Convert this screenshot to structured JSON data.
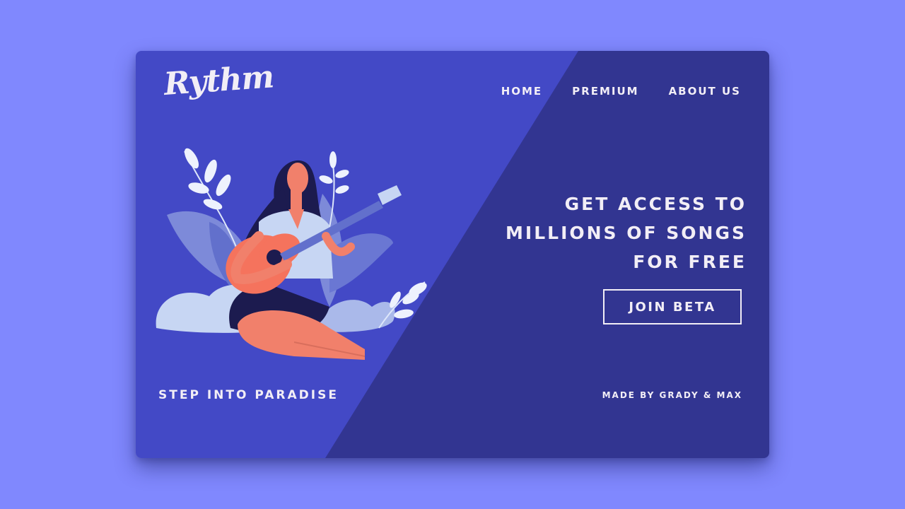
{
  "brand": {
    "logo_text": "Rythm"
  },
  "nav": {
    "home": "HOME",
    "premium": "PREMIUM",
    "about": "ABOUT US"
  },
  "hero": {
    "headline_lines": [
      "GET ACCESS TO",
      "MILLIONS OF SONGS",
      "FOR FREE"
    ],
    "cta_label": "JOIN BETA"
  },
  "footer": {
    "tagline": "STEP INTO PARADISE",
    "credits": "MADE BY GRADY & MAX"
  },
  "colors": {
    "page_background": "#8088fe",
    "card_left": "#4349c6",
    "card_right": "#323591",
    "text": "#f2eef6",
    "accent_skin": "#f1806b",
    "hair": "#1c1b4f",
    "leaf_light": "#c7d6f3",
    "leaf_mid": "#7d8ad9"
  },
  "illustration": {
    "icon": "girl-playing-guitar-illustration"
  }
}
